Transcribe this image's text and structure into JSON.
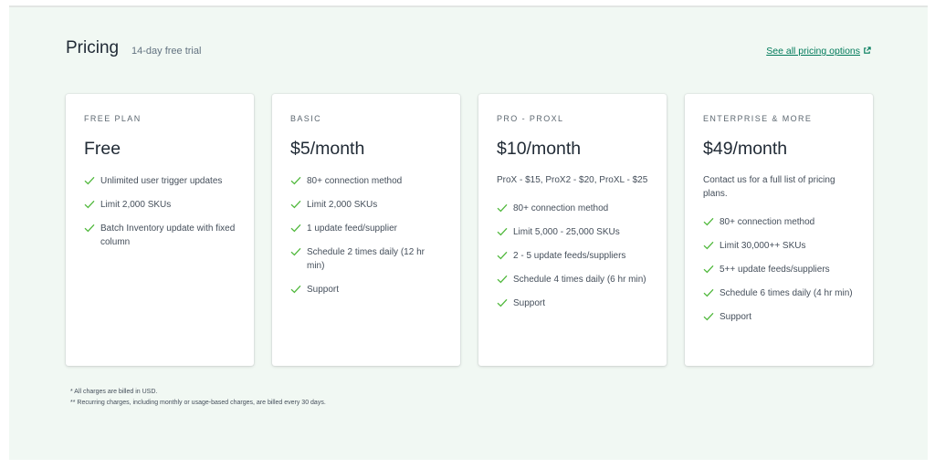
{
  "header": {
    "title": "Pricing",
    "subtitle": "14-day free trial",
    "all_pricing_link": "See all pricing options",
    "external_icon": "external-link-icon"
  },
  "plans": [
    {
      "name": "FREE PLAN",
      "price": "Free",
      "note": "",
      "features": [
        "Unlimited user trigger updates",
        "Limit 2,000 SKUs",
        "Batch Inventory update with fixed column"
      ]
    },
    {
      "name": "BASIC",
      "price": "$5/month",
      "note": "",
      "features": [
        "80+ connection method",
        "Limit 2,000 SKUs",
        "1 update feed/supplier",
        "Schedule 2 times daily (12 hr min)",
        "Support"
      ]
    },
    {
      "name": "PRO - PROXL",
      "price": "$10/month",
      "note": "ProX - $15, ProX2 - $20, ProXL - $25",
      "features": [
        "80+ connection method",
        "Limit 5,000 - 25,000 SKUs",
        "2 - 5 update feeds/suppliers",
        "Schedule 4 times daily (6 hr min)",
        "Support"
      ]
    },
    {
      "name": "ENTERPRISE & MORE",
      "price": "$49/month",
      "note": "Contact us for a full list of pricing plans.",
      "features": [
        "80+ connection method",
        "Limit 30,000++ SKUs",
        "5++ update feeds/suppliers",
        "Schedule 6 times daily (4 hr min)",
        "Support"
      ]
    }
  ],
  "footnotes": [
    "* All charges are billed in USD.",
    "** Recurring charges, including monthly or usage-based charges, are billed every 30 days."
  ],
  "colors": {
    "background": "#f1f8f3",
    "check": "#50b83c",
    "link": "#007a5a"
  }
}
